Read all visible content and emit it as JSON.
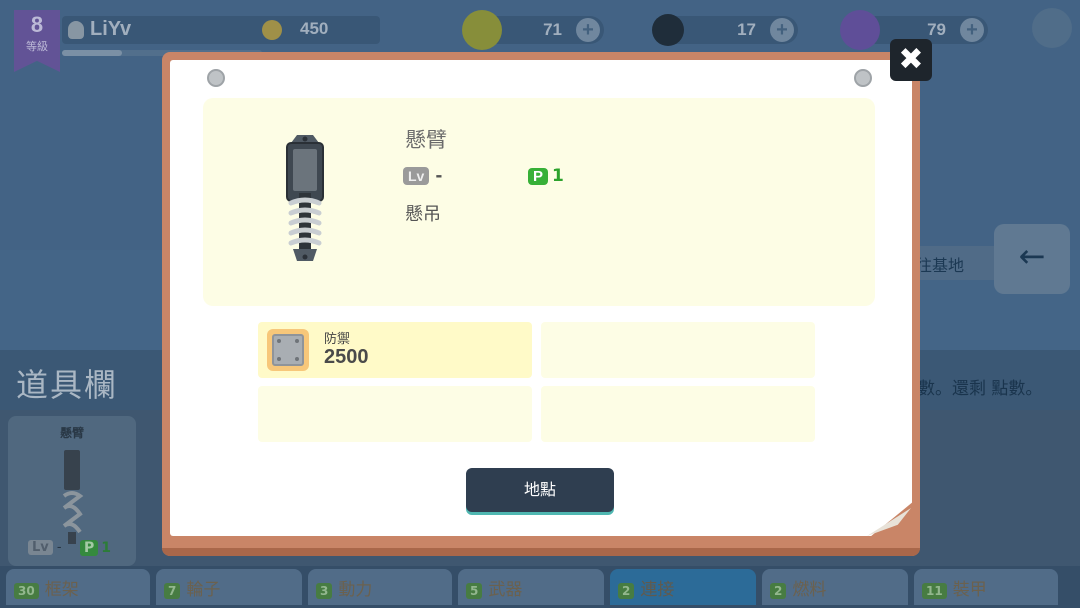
{
  "hud": {
    "level": "8",
    "level_label": "等級",
    "player_name": "LiYv",
    "coins": "450",
    "xp_progress": 0.3,
    "resource_1": "71",
    "resource_2": "17",
    "resource_3": "79"
  },
  "inventory": {
    "title": "道具欄",
    "card_label": "懸臂",
    "card_lv_chip": "Lv",
    "card_lv_value": "-",
    "card_p_chip": "P",
    "card_p_value": "1"
  },
  "background_right": {
    "goto_base": "往基地",
    "hint": "數。還剩 點數。"
  },
  "tabs": [
    {
      "count": "30",
      "label": "框架"
    },
    {
      "count": "7",
      "label": "輪子"
    },
    {
      "count": "3",
      "label": "動力"
    },
    {
      "count": "5",
      "label": "武器"
    },
    {
      "count": "2",
      "label": "連接"
    },
    {
      "count": "2",
      "label": "燃料"
    },
    {
      "count": "11",
      "label": "裝甲"
    }
  ],
  "active_tab": "連接",
  "modal": {
    "close_symbol": "✖",
    "part_name": "懸臂",
    "lv_chip": "Lv",
    "lv_value": "-",
    "p_chip": "P",
    "p_value": "1",
    "category": "懸吊",
    "stats": [
      {
        "label": "防禦",
        "value": "2500"
      }
    ],
    "place_button": "地點"
  },
  "colors": {
    "board": "#c98567",
    "panel": "#fdfde5",
    "stat_filled": "#fffac8",
    "button": "#2f3e50",
    "button_accent": "#4fb7b1",
    "p_green": "#37b037"
  }
}
